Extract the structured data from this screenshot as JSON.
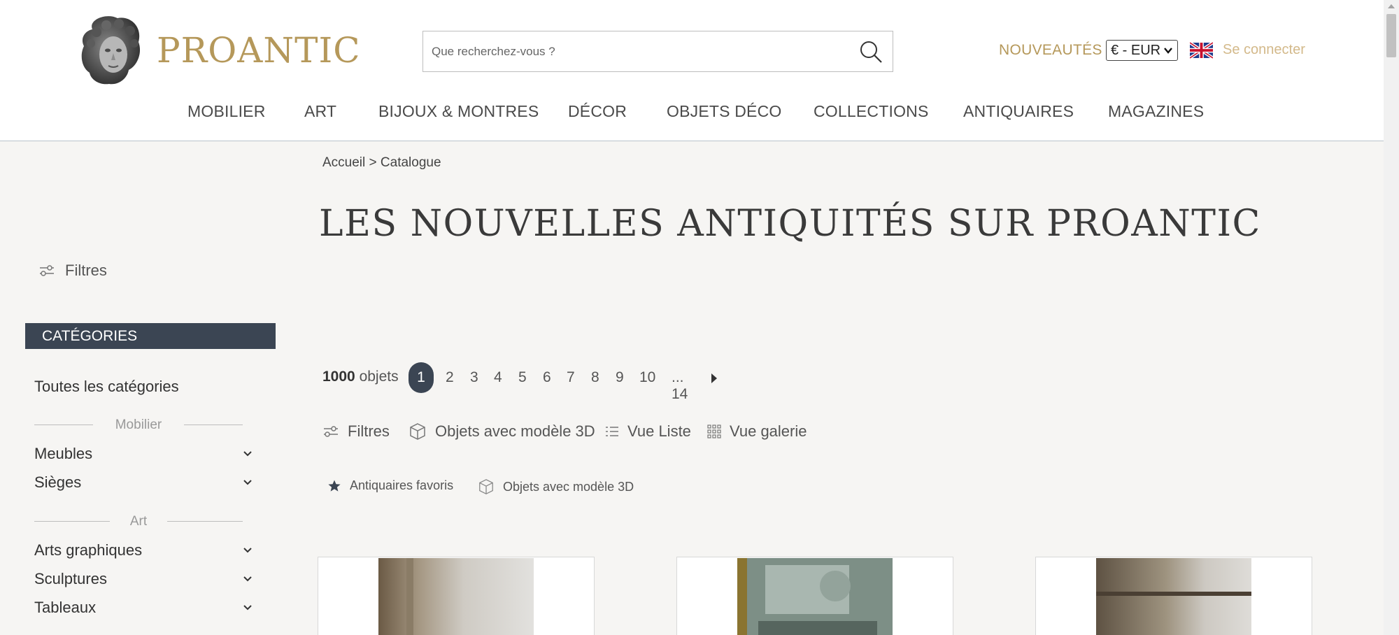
{
  "header": {
    "logo_text": "PROANTIC",
    "search_placeholder": "Que recherchez-vous ?",
    "nouveautes": "NOUVEAUTÉS",
    "currency": "€ - EUR",
    "login": "Se connecter"
  },
  "nav": [
    "MOBILIER",
    "ART",
    "BIJOUX & MONTRES",
    "DÉCOR",
    "OBJETS DÉCO",
    "COLLECTIONS",
    "ANTIQUAIRES",
    "MAGAZINES"
  ],
  "breadcrumb": "Accueil > Catalogue",
  "page_title": "LES NOUVELLES ANTIQUITÉS SUR PROANTIC",
  "sidebar": {
    "filters_label": "Filtres",
    "categories_header": "CATÉGORIES",
    "all_categories": "Toutes les catégories",
    "groups": [
      {
        "label": "Mobilier",
        "items": [
          "Meubles",
          "Sièges"
        ]
      },
      {
        "label": "Art",
        "items": [
          "Arts graphiques",
          "Sculptures",
          "Tableaux"
        ]
      }
    ]
  },
  "results": {
    "count": "1000",
    "count_suffix": "objets",
    "pages": [
      "1",
      "2",
      "3",
      "4",
      "5",
      "6",
      "7",
      "8",
      "9",
      "10",
      "... 14"
    ],
    "current_page": "1"
  },
  "toolbar": {
    "filters": "Filtres",
    "models_3d": "Objets avec modèle 3D",
    "list_view": "Vue Liste",
    "gallery_view": "Vue galerie"
  },
  "chips": {
    "fav_dealers": "Antiquaires favoris",
    "models_3d": "Objets avec modèle 3D"
  },
  "colors": {
    "brand_gold": "#b5985a",
    "dark_slate": "#3b4553",
    "page_bg": "#f6f5f3"
  }
}
